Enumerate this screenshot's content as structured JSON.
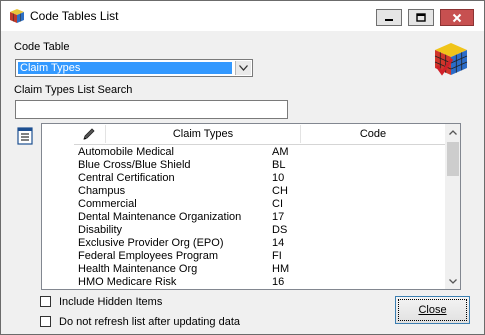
{
  "window": {
    "title": "Code Tables List"
  },
  "code_table": {
    "label": "Code Table",
    "selected": "Claim Types"
  },
  "search": {
    "label": "Claim Types List Search",
    "value": "",
    "placeholder": ""
  },
  "list": {
    "columns": [
      "Claim Types",
      "Code"
    ],
    "rows": [
      {
        "name": "Automobile Medical",
        "code": "AM"
      },
      {
        "name": "Blue Cross/Blue Shield",
        "code": "BL"
      },
      {
        "name": "Central Certification",
        "code": "10"
      },
      {
        "name": "Champus",
        "code": "CH"
      },
      {
        "name": "Commercial",
        "code": "CI"
      },
      {
        "name": "Dental Maintenance Organization",
        "code": "17"
      },
      {
        "name": "Disability",
        "code": "DS"
      },
      {
        "name": "Exclusive Provider Org (EPO)",
        "code": "14"
      },
      {
        "name": "Federal Employees Program",
        "code": "FI"
      },
      {
        "name": "Health Maintenance Org",
        "code": "HM"
      },
      {
        "name": "HMO Medicare Risk",
        "code": "16"
      }
    ]
  },
  "options": {
    "include_hidden": "Include Hidden Items",
    "no_refresh": "Do not refresh list after updating data"
  },
  "buttons": {
    "close": "Close"
  }
}
